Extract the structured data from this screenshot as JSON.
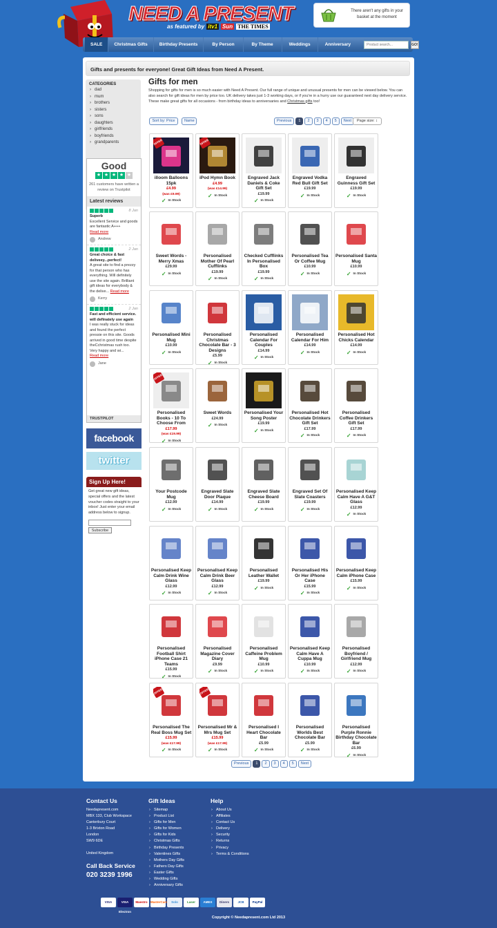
{
  "brand": {
    "logo": "NEED A PRESENT",
    "featured": "as featured by",
    "itv": "itv1",
    "sun": "Sun",
    "times": "THE TIMES"
  },
  "basket": {
    "text": "There aren't any gifts in your basket at the moment",
    "icon": "basket-icon"
  },
  "nav": {
    "items": [
      "SALE",
      "Christmas Gifts",
      "Birthday Presents",
      "By Person",
      "By Theme",
      "Weddings",
      "Anniversary"
    ],
    "search_placeholder": "Product search...",
    "go": "GO!"
  },
  "banner": "Gifts and presents for everyone! Great Gift Ideas from Need A Present.",
  "categories": {
    "title": "CATEGORIES",
    "items": [
      "dad",
      "mum",
      "brothers",
      "sisters",
      "sons",
      "daughters",
      "girlfriends",
      "boyfriends",
      "grandparents"
    ]
  },
  "trustpilot": {
    "rating": "Good",
    "count_text": "261 customers have written a review on Trustpilot",
    "latest": "Latest reviews",
    "reviews": [
      {
        "date": "8 Jan",
        "title": "Superb",
        "text": "Excellent Service and goods are fantastic A+++",
        "more": "Read more",
        "author": "Andrew"
      },
      {
        "date": "2 Jan",
        "title": "Great choice & fast deliveey...perfect!",
        "text": "A great site to find a prezzy for that person who has everything. Will definitely use the site again. Brilliant gift ideas for everybody & the delive...",
        "more": "Read more",
        "author": "Kerry"
      },
      {
        "date": "2 Jan",
        "title": "Fast and efficient service. will definately use again",
        "text": "I was really stuck for ideas and found the perfect pressie on this site. Goods arrived in good time despite theCchristmas rush too. Very happy and wi...",
        "more": "Read more",
        "author": "Jane"
      }
    ],
    "footer": "TRUSTPILOT"
  },
  "social": {
    "facebook": "facebook",
    "twitter": "twitter"
  },
  "signup": {
    "title": "Sign Up Here!",
    "text": "Get great new gift ideas, special offers and the latest voucher codes straight to your inbox! Just enter your email address below to signup.",
    "button": "Subscribe"
  },
  "page": {
    "title": "Gifts for men",
    "intro": "Shopping for gifts for men is so much easier with Need A Present. Our full range of unique and unusual presents for men can be viewed below. You can also search for gift ideas for men by price too. UK delivery takes just 1-3 working days, or if you're in a hurry use our guaranteed next day delivery service. These make great gifts for all occasions - from birthday ideas to anniversaries and",
    "intro_link": "Christmas gifts",
    "intro_end": "too!"
  },
  "sort": {
    "by_price": "Sort by: Price",
    "name": "Name",
    "page_size": "Page size: ↕"
  },
  "pagination": {
    "prev": "Previous",
    "pages": [
      "1",
      "2",
      "3",
      "4",
      "5"
    ],
    "next": "Next"
  },
  "products": [
    {
      "name": "illoom Balloons 15pk",
      "price": "£4.99",
      "was": "(was £9.99)",
      "sale": true,
      "stock": "In Stock",
      "img": "balloons"
    },
    {
      "name": "iPod Hymn Book",
      "price": "£4.99",
      "was": "(was £14.99)",
      "sale": true,
      "stock": "In Stock",
      "img": "book"
    },
    {
      "name": "Engraved Jack Daniels & Coke Gift Set",
      "price": "£19.99",
      "was": "",
      "sale": false,
      "stock": "In Stock",
      "img": "jd"
    },
    {
      "name": "Engraved Vodka Red Bull Gift Set",
      "price": "£19.99",
      "was": "",
      "sale": false,
      "stock": "In Stock",
      "img": "vodka"
    },
    {
      "name": "Engraved Guinness Gift Set",
      "price": "£19.99",
      "was": "",
      "sale": false,
      "stock": "In Stock",
      "img": "guinness"
    },
    {
      "name": "Sweet Words - Merry Xmas",
      "price": "£29.99",
      "was": "",
      "sale": false,
      "stock": "In Stock",
      "img": "sweets"
    },
    {
      "name": "Personalised Mother Of Pearl Cufflinks",
      "price": "£19.99",
      "was": "",
      "sale": false,
      "stock": "In Stock",
      "img": "cufflinks"
    },
    {
      "name": "Checked Cufflinks In Personalised Box",
      "price": "£19.99",
      "was": "",
      "sale": false,
      "stock": "In Stock",
      "img": "cbox"
    },
    {
      "name": "Personalised Tea Or Coffee Mug",
      "price": "£10.99",
      "was": "",
      "sale": false,
      "stock": "In Stock",
      "img": "teamug"
    },
    {
      "name": "Personalised Santa Mug",
      "price": "£10.99",
      "was": "",
      "sale": false,
      "stock": "In Stock",
      "img": "santamug"
    },
    {
      "name": "Personalised Mini Mug",
      "price": "£10.99",
      "was": "",
      "sale": false,
      "stock": "In Stock",
      "img": "minimug"
    },
    {
      "name": "Personalised Christmas Chocolate Bar - 3 Designs",
      "price": "£5.99",
      "was": "",
      "sale": false,
      "stock": "In Stock",
      "img": "xmasbar"
    },
    {
      "name": "Personalised Calendar For Couples",
      "price": "£14.99",
      "was": "",
      "sale": false,
      "stock": "In Stock",
      "img": "calcouple"
    },
    {
      "name": "Personalised Calendar For Him",
      "price": "£14.99",
      "was": "",
      "sale": false,
      "stock": "In Stock",
      "img": "calhim"
    },
    {
      "name": "Personalised Hot Chicks Calendar",
      "price": "£14.99",
      "was": "",
      "sale": false,
      "stock": "In Stock",
      "img": "chicks"
    },
    {
      "name": "Personalised Books - 10 To Choose From",
      "price": "£17.99",
      "was": "(was £19.99)",
      "sale": true,
      "stock": "In Stock",
      "img": "books"
    },
    {
      "name": "Sweet Words",
      "price": "£24.99",
      "was": "",
      "sale": false,
      "stock": "In Stock",
      "img": "sweetwords"
    },
    {
      "name": "Personalised Your Song Poster",
      "price": "£19.99",
      "was": "",
      "sale": false,
      "stock": "In Stock",
      "img": "poster"
    },
    {
      "name": "Personalised Hot Chocolate Drinkers Gift Set",
      "price": "£17.99",
      "was": "",
      "sale": false,
      "stock": "In Stock",
      "img": "hotchoc"
    },
    {
      "name": "Personalised Coffee Drinkers Gift Set",
      "price": "£17.99",
      "was": "",
      "sale": false,
      "stock": "In Stock",
      "img": "coffee"
    },
    {
      "name": "Your Postcode Mug",
      "price": "£12.99",
      "was": "",
      "sale": false,
      "stock": "In Stock",
      "img": "postcode"
    },
    {
      "name": "Engraved Slate Door Plaque",
      "price": "£14.99",
      "was": "",
      "sale": false,
      "stock": "In Stock",
      "img": "plaque"
    },
    {
      "name": "Engraved Slate Cheese Board",
      "price": "£19.99",
      "was": "",
      "sale": false,
      "stock": "In Stock",
      "img": "cheese"
    },
    {
      "name": "Engraved Set Of Slate Coasters",
      "price": "£19.99",
      "was": "",
      "sale": false,
      "stock": "In Stock",
      "img": "coasters"
    },
    {
      "name": "Personalised Keep Calm Have A G&T Glass",
      "price": "£12.99",
      "was": "",
      "sale": false,
      "stock": "In Stock",
      "img": "gtglass"
    },
    {
      "name": "Personalised Keep Calm Drink Wine Glass",
      "price": "£12.99",
      "was": "",
      "sale": false,
      "stock": "In Stock",
      "img": "wine"
    },
    {
      "name": "Personalised Keep Calm Drink Beer Glass",
      "price": "£12.99",
      "was": "",
      "sale": false,
      "stock": "In Stock",
      "img": "beer"
    },
    {
      "name": "Personalised Leather Wallet",
      "price": "£19.99",
      "was": "",
      "sale": false,
      "stock": "In Stock",
      "img": "wallet"
    },
    {
      "name": "Personalised His Or Her iPhone Case",
      "price": "£15.99",
      "was": "",
      "sale": false,
      "stock": "In Stock",
      "img": "hisher"
    },
    {
      "name": "Personalised Keep Calm iPhone Case",
      "price": "£15.99",
      "was": "",
      "sale": false,
      "stock": "In Stock",
      "img": "kcphone"
    },
    {
      "name": "Personalised Football Shirt iPhone Case 21 Teams",
      "price": "£15.99",
      "was": "",
      "sale": false,
      "stock": "In Stock",
      "img": "football"
    },
    {
      "name": "Personalised Magazine Cover Diary",
      "price": "£9.99",
      "was": "",
      "sale": false,
      "stock": "In Stock",
      "img": "diary"
    },
    {
      "name": "Personalised Caffeine Problem Mug",
      "price": "£10.99",
      "was": "",
      "sale": false,
      "stock": "In Stock",
      "img": "caffeine"
    },
    {
      "name": "Personalised Keep Calm Have A Cuppa Mug",
      "price": "£10.99",
      "was": "",
      "sale": false,
      "stock": "In Stock",
      "img": "cuppa"
    },
    {
      "name": "Personalised Boyfriend / Girlfriend Mug",
      "price": "£12.99",
      "was": "",
      "sale": false,
      "stock": "In Stock",
      "img": "bfmug"
    },
    {
      "name": "Personalised The Real Boss Mug Set",
      "price": "£15.99",
      "was": "(was £17.99)",
      "sale": true,
      "stock": "In Stock",
      "img": "boss"
    },
    {
      "name": "Personalised Mr & Mrs Mug Set",
      "price": "£15.99",
      "was": "(was £17.99)",
      "sale": true,
      "stock": "In Stock",
      "img": "mrmrs"
    },
    {
      "name": "Personalised I Heart Chocolate Bar",
      "price": "£5.99",
      "was": "",
      "sale": false,
      "stock": "In Stock",
      "img": "iheart"
    },
    {
      "name": "Personalised Worlds Best Chocolate Bar",
      "price": "£5.99",
      "was": "",
      "sale": false,
      "stock": "In Stock",
      "img": "worldsbest"
    },
    {
      "name": "Personalised Purple Ronnie Birthday Chocolate Bar",
      "price": "£6.99",
      "was": "",
      "sale": false,
      "stock": "In Stock",
      "img": "ronnie"
    }
  ],
  "footer": {
    "contact": {
      "title": "Contact Us",
      "lines": [
        "Needapresent.com",
        "MBX 133, Club Workspace",
        "Canterbury Court",
        "1-3 Brixton Road",
        "London",
        "SW9 6DE",
        "",
        "United Kingdom"
      ],
      "call": "Call Back Service",
      "phone": "020 3239 1996"
    },
    "ideas": {
      "title": "Gift Ideas",
      "links": [
        "Sitemap",
        "Product List",
        "Gifts for Men",
        "Gifts for Women",
        "Gifts for Kids",
        "Christmas Gifts",
        "Birthday Presents",
        "Valentines Gifts",
        "Mothers Day Gifts",
        "Fathers Day Gifts",
        "Easter Gifts",
        "Wedding Gifts",
        "Anniversary Gifts"
      ]
    },
    "help": {
      "title": "Help",
      "links": [
        "About Us",
        "Affiliates",
        "Contact Us",
        "Delivery",
        "Security",
        "Returns",
        "Privacy",
        "Terms & Conditions"
      ]
    },
    "payments": [
      "VISA",
      "VISA Electron",
      "Maestro",
      "MasterCard",
      "Solo",
      "Laser",
      "AMEX",
      "Diners",
      "JCB",
      "PayPal"
    ],
    "copyright": "Copyright © Needapresent.com Ltd 2013"
  }
}
